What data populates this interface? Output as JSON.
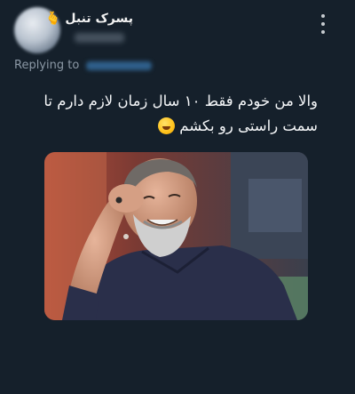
{
  "header": {
    "username": "پسرک تنبل",
    "username_emoji": "🫰",
    "avatar_icon": "user-avatar",
    "more_icon": "more-vertical-icon"
  },
  "reply": {
    "label": "Replying to"
  },
  "tweet": {
    "line1": "والا من خودم فقط ۱۰ سال زمان لازم دارم تا",
    "line2": "سمت راستی رو بکشم",
    "emoji_icon": "laughing-sweat-emoji"
  },
  "media": {
    "description_icon": "photo-laughing-bearded-man"
  },
  "colors": {
    "background": "#15202b",
    "text": "#e7e9ea",
    "muted": "#8b98a5",
    "link": "#1d9bf0"
  }
}
